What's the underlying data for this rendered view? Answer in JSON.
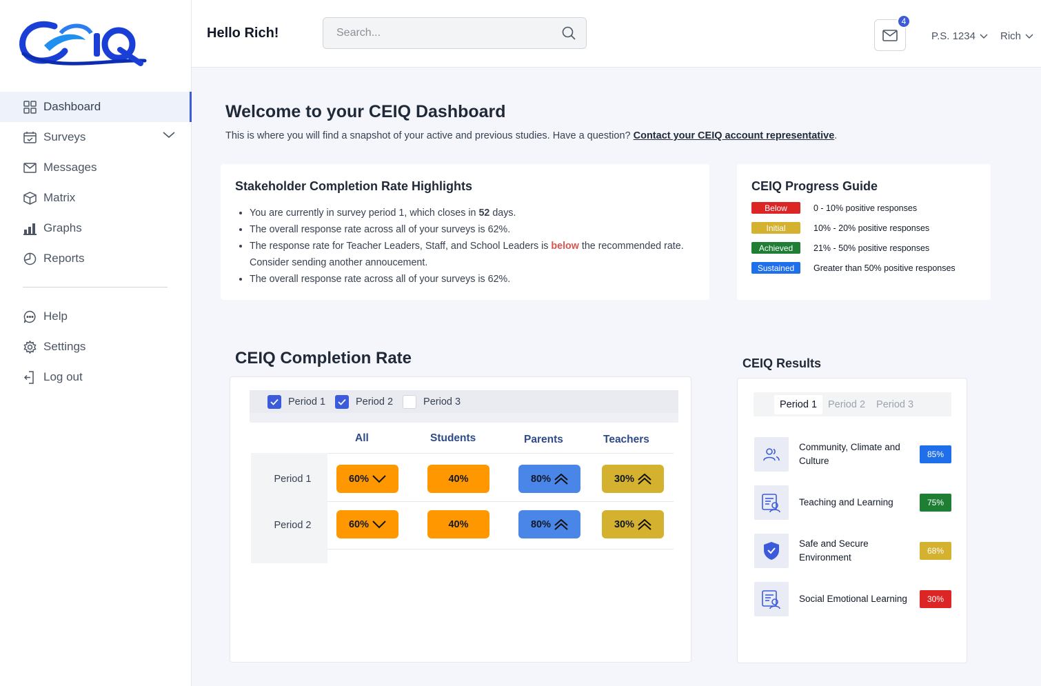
{
  "app": {
    "logo_text": "CEIQ"
  },
  "sidebar": {
    "items": [
      {
        "label": "Dashboard",
        "icon": "grid-icon",
        "active": true
      },
      {
        "label": "Surveys",
        "icon": "calendar-check-icon",
        "expandable": true
      },
      {
        "label": "Messages",
        "icon": "envelope-icon"
      },
      {
        "label": "Matrix",
        "icon": "cube-icon"
      },
      {
        "label": "Graphs",
        "icon": "bar-chart-icon"
      },
      {
        "label": "Reports",
        "icon": "pie-chart-icon"
      }
    ],
    "secondary": [
      {
        "label": "Help",
        "icon": "chat-bubble-icon"
      },
      {
        "label": "Settings",
        "icon": "gear-icon"
      },
      {
        "label": "Log out",
        "icon": "logout-icon"
      }
    ]
  },
  "header": {
    "greeting": "Hello Rich!",
    "search_placeholder": "Search...",
    "mail_count": "4",
    "school": "P.S. 1234",
    "user": "Rich"
  },
  "welcome": {
    "title": "Welcome to your CEIQ Dashboard",
    "subtitle": "This is where you will find a snapshot of your active and previous studies.  Have a question? ",
    "link": "Contact your CEIQ account representative",
    "link_suffix": "."
  },
  "highlights": {
    "title": "Stakeholder Completion Rate Highlights",
    "b1_pre": "You are currently in survey period 1, which closes in ",
    "b1_bold": "52",
    "b1_post": " days.",
    "b2": "The overall response rate across all of your surveys is 62%.",
    "b3_pre": "The response rate for Teacher Leaders, Staff, and School Leaders is ",
    "b3_emph": "below",
    "b3_post": " the recommended rate. Consider sending another annoucement.",
    "b4": "The overall response rate across all of your surveys is 62%."
  },
  "guide": {
    "title": "CEIQ Progress Guide",
    "levels": [
      {
        "tag": "Below",
        "desc": "0 - 10% positive responses",
        "color": "#dc2626"
      },
      {
        "tag": "Initial",
        "desc": "10% - 20% positive responses",
        "color": "#d4b12f"
      },
      {
        "tag": "Achieved",
        "desc": "21% - 50% positive responses",
        "color": "#1e7e34"
      },
      {
        "tag": "Sustained",
        "desc": "Greater than 50% positive responses",
        "color": "#1f6feb"
      }
    ]
  },
  "completion": {
    "title": "CEIQ Completion Rate",
    "filters": [
      {
        "label": "Period 1",
        "checked": true
      },
      {
        "label": "Period 2",
        "checked": true
      },
      {
        "label": "Period 3",
        "checked": false
      }
    ],
    "columns": [
      "All",
      "Students",
      "Parents",
      "Teachers"
    ],
    "rows": [
      {
        "label": "Period 1",
        "cells": [
          "60%",
          "40%",
          "80%",
          "30%"
        ]
      },
      {
        "label": "Period 2",
        "cells": [
          "60%",
          "40%",
          "80%",
          "30%"
        ]
      }
    ],
    "cell_colors": [
      "#ff9800",
      "#ff9800",
      "#4a86e8",
      "#d4b12f"
    ],
    "cell_icons": [
      "chevron-down-icon",
      "",
      "double-chevron-up-icon",
      "double-chevron-up-icon"
    ]
  },
  "results": {
    "title": "CEIQ Results",
    "tabs": [
      "Period 1",
      "Period 2",
      "Period 3"
    ],
    "active_tab": "Period 1",
    "items": [
      {
        "label": "Community, Climate and Culture",
        "value": "85%",
        "color": "#1f6feb",
        "icon": "people-icon"
      },
      {
        "label": "Teaching and Learning",
        "value": "75%",
        "color": "#1e7e34",
        "icon": "document-icon"
      },
      {
        "label": "Safe and Secure Environment",
        "value": "68%",
        "color": "#d4b12f",
        "icon": "shield-icon"
      },
      {
        "label": "Social Emotional Learning",
        "value": "30%",
        "color": "#dc2626",
        "icon": "document-icon"
      }
    ]
  }
}
